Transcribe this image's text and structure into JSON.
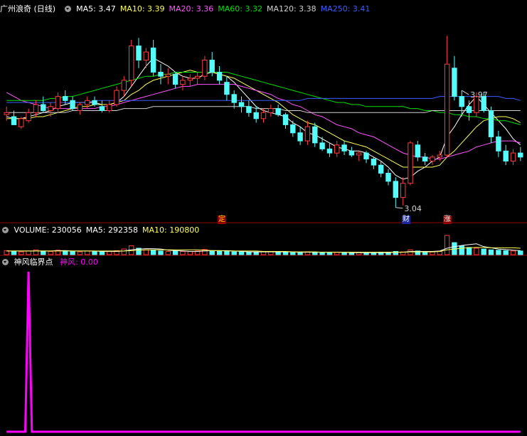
{
  "colors": {
    "up": "#ff3c3c",
    "down": "#54fcfc",
    "ma5": "#ffffff",
    "ma10": "#ffff54",
    "ma20": "#ff54ff",
    "ma60": "#00e000",
    "ma120": "#d0d0d0",
    "ma250": "#3c5cff",
    "grid": "#8b0000",
    "vol_ma5": "#ffffff",
    "vol_ma10": "#ffff54",
    "indicator": "#ff00ff"
  },
  "main_panel": {
    "title": "广州浪奇 (日线)",
    "ma_labels": [
      {
        "text": "MA5: 3.47",
        "color": "#ffffff"
      },
      {
        "text": "MA10: 3.39",
        "color": "#ffff54"
      },
      {
        "text": "MA20: 3.36",
        "color": "#ff54ff"
      },
      {
        "text": "MA60: 3.32",
        "color": "#00e000"
      },
      {
        "text": "MA120: 3.38",
        "color": "#d0d0d0"
      },
      {
        "text": "MA250: 3.41",
        "color": "#3c5cff"
      }
    ],
    "high_label": "3.97",
    "low_label": "3.04",
    "tags": [
      "定",
      "财",
      "涨"
    ]
  },
  "volume_panel": {
    "labels": [
      {
        "text": "VOLUME: 230056",
        "color": "#ffffff"
      },
      {
        "text": "MA5: 292358",
        "color": "#ffffff"
      },
      {
        "text": "MA10: 190800",
        "color": "#ffff54"
      }
    ]
  },
  "indicator_panel": {
    "name": "神风临界点",
    "series_label": "神风: 0.00"
  },
  "chart_data": [
    {
      "type": "candlestick",
      "title": "广州浪奇 (日线)",
      "ylim": [
        3.0,
        4.0
      ],
      "ohlc": [
        [
          3.51,
          3.55,
          3.48,
          3.52
        ],
        [
          3.5,
          3.53,
          3.46,
          3.46
        ],
        [
          3.45,
          3.5,
          3.44,
          3.49
        ],
        [
          3.48,
          3.54,
          3.47,
          3.52
        ],
        [
          3.52,
          3.58,
          3.5,
          3.56
        ],
        [
          3.56,
          3.6,
          3.52,
          3.53
        ],
        [
          3.53,
          3.57,
          3.5,
          3.55
        ],
        [
          3.54,
          3.62,
          3.52,
          3.6
        ],
        [
          3.6,
          3.63,
          3.56,
          3.58
        ],
        [
          3.58,
          3.6,
          3.53,
          3.54
        ],
        [
          3.53,
          3.57,
          3.51,
          3.56
        ],
        [
          3.56,
          3.6,
          3.54,
          3.58
        ],
        [
          3.58,
          3.6,
          3.55,
          3.56
        ],
        [
          3.55,
          3.58,
          3.52,
          3.53
        ],
        [
          3.53,
          3.58,
          3.52,
          3.56
        ],
        [
          3.56,
          3.65,
          3.55,
          3.63
        ],
        [
          3.63,
          3.7,
          3.6,
          3.68
        ],
        [
          3.68,
          3.88,
          3.65,
          3.85
        ],
        [
          3.85,
          3.89,
          3.74,
          3.78
        ],
        [
          3.78,
          3.84,
          3.74,
          3.82
        ],
        [
          3.84,
          3.88,
          3.7,
          3.72
        ],
        [
          3.72,
          3.76,
          3.66,
          3.7
        ],
        [
          3.7,
          3.74,
          3.66,
          3.71
        ],
        [
          3.71,
          3.72,
          3.64,
          3.66
        ],
        [
          3.66,
          3.7,
          3.63,
          3.68
        ],
        [
          3.68,
          3.71,
          3.65,
          3.69
        ],
        [
          3.69,
          3.72,
          3.66,
          3.7
        ],
        [
          3.7,
          3.8,
          3.68,
          3.78
        ],
        [
          3.78,
          3.82,
          3.7,
          3.72
        ],
        [
          3.72,
          3.75,
          3.66,
          3.68
        ],
        [
          3.67,
          3.7,
          3.58,
          3.61
        ],
        [
          3.61,
          3.63,
          3.54,
          3.57
        ],
        [
          3.57,
          3.6,
          3.52,
          3.55
        ],
        [
          3.55,
          3.58,
          3.5,
          3.52
        ],
        [
          3.52,
          3.55,
          3.47,
          3.49
        ],
        [
          3.49,
          3.54,
          3.47,
          3.52
        ],
        [
          3.52,
          3.56,
          3.5,
          3.54
        ],
        [
          3.54,
          3.56,
          3.5,
          3.51
        ],
        [
          3.51,
          3.52,
          3.44,
          3.46
        ],
        [
          3.46,
          3.48,
          3.4,
          3.42
        ],
        [
          3.42,
          3.45,
          3.36,
          3.38
        ],
        [
          3.38,
          3.48,
          3.36,
          3.45
        ],
        [
          3.45,
          3.47,
          3.35,
          3.37
        ],
        [
          3.37,
          3.4,
          3.33,
          3.34
        ],
        [
          3.34,
          3.37,
          3.3,
          3.32
        ],
        [
          3.32,
          3.38,
          3.3,
          3.36
        ],
        [
          3.36,
          3.38,
          3.31,
          3.33
        ],
        [
          3.33,
          3.35,
          3.3,
          3.31
        ],
        [
          3.31,
          3.33,
          3.28,
          3.32
        ],
        [
          3.32,
          3.33,
          3.27,
          3.29
        ],
        [
          3.29,
          3.3,
          3.24,
          3.26
        ],
        [
          3.26,
          3.28,
          3.2,
          3.22
        ],
        [
          3.22,
          3.24,
          3.16,
          3.18
        ],
        [
          3.18,
          3.2,
          3.05,
          3.1
        ],
        [
          3.1,
          3.2,
          3.06,
          3.17
        ],
        [
          3.17,
          3.38,
          3.16,
          3.37
        ],
        [
          3.36,
          3.38,
          3.28,
          3.3
        ],
        [
          3.3,
          3.32,
          3.26,
          3.28
        ],
        [
          3.28,
          3.31,
          3.26,
          3.3
        ],
        [
          3.3,
          3.33,
          3.28,
          3.31
        ],
        [
          3.31,
          3.9,
          3.3,
          3.76
        ],
        [
          3.74,
          3.8,
          3.58,
          3.6
        ],
        [
          3.6,
          3.63,
          3.5,
          3.55
        ],
        [
          3.55,
          3.58,
          3.48,
          3.52
        ],
        [
          3.52,
          3.62,
          3.5,
          3.6
        ],
        [
          3.6,
          3.62,
          3.52,
          3.53
        ],
        [
          3.53,
          3.55,
          3.37,
          3.4
        ],
        [
          3.4,
          3.43,
          3.3,
          3.33
        ],
        [
          3.33,
          3.36,
          3.26,
          3.28
        ],
        [
          3.28,
          3.34,
          3.26,
          3.32
        ],
        [
          3.32,
          3.35,
          3.28,
          3.3
        ]
      ],
      "moving_averages": {
        "MA5": [
          3.5,
          3.49,
          3.49,
          3.5,
          3.51,
          3.52,
          3.53,
          3.55,
          3.56,
          3.57,
          3.57,
          3.57,
          3.57,
          3.56,
          3.56,
          3.57,
          3.6,
          3.65,
          3.7,
          3.75,
          3.79,
          3.77,
          3.75,
          3.72,
          3.7,
          3.69,
          3.69,
          3.71,
          3.72,
          3.71,
          3.7,
          3.67,
          3.63,
          3.59,
          3.55,
          3.53,
          3.52,
          3.51,
          3.5,
          3.47,
          3.45,
          3.42,
          3.41,
          3.39,
          3.37,
          3.35,
          3.34,
          3.33,
          3.33,
          3.32,
          3.3,
          3.28,
          3.25,
          3.21,
          3.19,
          3.2,
          3.23,
          3.25,
          3.28,
          3.3,
          3.4,
          3.45,
          3.51,
          3.56,
          3.6,
          3.56,
          3.52,
          3.48,
          3.44,
          3.39,
          3.36
        ],
        "MA10": [
          3.49,
          3.49,
          3.49,
          3.49,
          3.5,
          3.5,
          3.51,
          3.52,
          3.53,
          3.54,
          3.55,
          3.55,
          3.56,
          3.56,
          3.56,
          3.57,
          3.58,
          3.61,
          3.63,
          3.66,
          3.68,
          3.69,
          3.7,
          3.71,
          3.72,
          3.73,
          3.72,
          3.72,
          3.72,
          3.71,
          3.7,
          3.69,
          3.67,
          3.65,
          3.63,
          3.61,
          3.59,
          3.57,
          3.54,
          3.51,
          3.49,
          3.47,
          3.46,
          3.44,
          3.42,
          3.4,
          3.38,
          3.37,
          3.36,
          3.35,
          3.33,
          3.31,
          3.29,
          3.27,
          3.25,
          3.25,
          3.25,
          3.25,
          3.25,
          3.26,
          3.3,
          3.33,
          3.37,
          3.41,
          3.45,
          3.48,
          3.49,
          3.5,
          3.5,
          3.49,
          3.47
        ],
        "MA20": [
          3.62,
          3.6,
          3.58,
          3.57,
          3.56,
          3.55,
          3.54,
          3.54,
          3.54,
          3.54,
          3.54,
          3.54,
          3.54,
          3.55,
          3.55,
          3.56,
          3.57,
          3.58,
          3.59,
          3.6,
          3.61,
          3.62,
          3.63,
          3.64,
          3.65,
          3.65,
          3.66,
          3.66,
          3.66,
          3.66,
          3.66,
          3.66,
          3.65,
          3.64,
          3.63,
          3.62,
          3.61,
          3.59,
          3.58,
          3.56,
          3.55,
          3.53,
          3.51,
          3.5,
          3.48,
          3.46,
          3.45,
          3.44,
          3.42,
          3.41,
          3.4,
          3.38,
          3.36,
          3.34,
          3.32,
          3.31,
          3.3,
          3.3,
          3.29,
          3.29,
          3.3,
          3.31,
          3.32,
          3.33,
          3.35,
          3.36,
          3.37,
          3.38,
          3.38,
          3.38,
          3.37
        ],
        "MA60": [
          3.58,
          3.58,
          3.58,
          3.58,
          3.58,
          3.58,
          3.59,
          3.59,
          3.6,
          3.6,
          3.61,
          3.62,
          3.63,
          3.64,
          3.65,
          3.66,
          3.67,
          3.68,
          3.69,
          3.7,
          3.7,
          3.71,
          3.71,
          3.72,
          3.72,
          3.72,
          3.72,
          3.72,
          3.72,
          3.72,
          3.72,
          3.71,
          3.7,
          3.69,
          3.68,
          3.67,
          3.66,
          3.65,
          3.64,
          3.63,
          3.62,
          3.61,
          3.6,
          3.59,
          3.58,
          3.57,
          3.57,
          3.56,
          3.56,
          3.55,
          3.55,
          3.55,
          3.55,
          3.55,
          3.55,
          3.54,
          3.54,
          3.53,
          3.53,
          3.52,
          3.52,
          3.51,
          3.51,
          3.5,
          3.5,
          3.49,
          3.49,
          3.48,
          3.48,
          3.47,
          3.46
        ],
        "MA120": [
          3.52,
          3.52,
          3.52,
          3.52,
          3.52,
          3.52,
          3.52,
          3.52,
          3.52,
          3.53,
          3.53,
          3.53,
          3.53,
          3.53,
          3.53,
          3.53,
          3.54,
          3.54,
          3.54,
          3.54,
          3.55,
          3.55,
          3.55,
          3.55,
          3.55,
          3.55,
          3.55,
          3.55,
          3.55,
          3.55,
          3.55,
          3.55,
          3.55,
          3.55,
          3.54,
          3.54,
          3.54,
          3.54,
          3.53,
          3.53,
          3.53,
          3.52,
          3.52,
          3.52,
          3.52,
          3.52,
          3.52,
          3.52,
          3.52,
          3.52,
          3.52,
          3.52,
          3.52,
          3.52,
          3.52,
          3.52,
          3.52,
          3.52,
          3.53,
          3.53,
          3.53,
          3.53,
          3.53,
          3.53,
          3.53,
          3.53,
          3.53,
          3.53,
          3.53,
          3.53,
          3.53
        ],
        "MA250": [
          3.57,
          3.57,
          3.57,
          3.57,
          3.57,
          3.57,
          3.57,
          3.57,
          3.57,
          3.57,
          3.57,
          3.57,
          3.58,
          3.58,
          3.58,
          3.58,
          3.58,
          3.58,
          3.58,
          3.58,
          3.58,
          3.58,
          3.58,
          3.58,
          3.58,
          3.58,
          3.58,
          3.58,
          3.58,
          3.58,
          3.58,
          3.58,
          3.58,
          3.58,
          3.58,
          3.58,
          3.58,
          3.58,
          3.58,
          3.58,
          3.58,
          3.59,
          3.59,
          3.59,
          3.59,
          3.59,
          3.59,
          3.59,
          3.59,
          3.59,
          3.59,
          3.59,
          3.59,
          3.59,
          3.59,
          3.59,
          3.59,
          3.59,
          3.59,
          3.6,
          3.6,
          3.6,
          3.6,
          3.6,
          3.6,
          3.6,
          3.6,
          3.6,
          3.59,
          3.59,
          3.58
        ]
      },
      "annotations": [
        {
          "text": "3.97",
          "bar": 62
        },
        {
          "text": "3.04",
          "bar": 53
        }
      ],
      "events": [
        {
          "text": "定",
          "bar": 30
        },
        {
          "text": "财",
          "bar": 55
        },
        {
          "text": "涨",
          "bar": 61
        }
      ]
    },
    {
      "type": "bar",
      "title": "VOLUME",
      "values": [
        10,
        8,
        7,
        9,
        12,
        9,
        8,
        11,
        10,
        8,
        7,
        9,
        8,
        7,
        8,
        10,
        14,
        22,
        16,
        12,
        11,
        9,
        8,
        9,
        8,
        8,
        9,
        13,
        10,
        9,
        8,
        7,
        7,
        6,
        6,
        7,
        8,
        7,
        6,
        6,
        6,
        7,
        6,
        5,
        5,
        6,
        5,
        5,
        5,
        5,
        5,
        6,
        6,
        8,
        7,
        12,
        9,
        7,
        7,
        8,
        48,
        30,
        22,
        18,
        16,
        14,
        12,
        11,
        10,
        9,
        9
      ],
      "ma5": [
        9,
        9,
        9,
        9,
        9,
        9,
        9,
        10,
        10,
        9,
        9,
        9,
        9,
        8,
        8,
        8,
        9,
        12,
        14,
        15,
        15,
        14,
        11,
        10,
        9,
        8,
        8,
        9,
        10,
        10,
        10,
        9,
        8,
        7,
        7,
        7,
        7,
        7,
        7,
        7,
        6,
        6,
        6,
        6,
        6,
        6,
        6,
        5,
        5,
        5,
        5,
        5,
        5,
        6,
        6,
        8,
        8,
        8,
        8,
        9,
        16,
        20,
        23,
        25,
        27,
        20,
        17,
        14,
        13,
        11,
        10
      ],
      "ma10": [
        9,
        9,
        9,
        9,
        9,
        9,
        9,
        9,
        9,
        9,
        9,
        9,
        9,
        9,
        9,
        9,
        9,
        10,
        11,
        12,
        12,
        12,
        12,
        12,
        12,
        12,
        12,
        11,
        10,
        10,
        9,
        9,
        9,
        9,
        9,
        8,
        8,
        8,
        8,
        7,
        7,
        7,
        7,
        6,
        6,
        6,
        6,
        6,
        6,
        6,
        6,
        6,
        6,
        6,
        6,
        7,
        7,
        7,
        7,
        8,
        12,
        14,
        16,
        17,
        18,
        18,
        17,
        17,
        17,
        17,
        16
      ]
    },
    {
      "type": "line",
      "title": "神风临界点",
      "series": [
        {
          "name": "神风",
          "values": [
            0,
            0,
            0,
            0,
            0,
            0,
            0,
            0,
            0,
            0,
            0,
            0,
            0,
            0,
            0,
            0,
            0,
            0,
            0,
            0,
            0,
            0,
            0,
            0,
            0,
            0,
            0,
            0,
            0,
            0,
            0,
            0,
            0,
            0,
            0,
            0,
            0,
            0,
            0,
            0,
            0,
            0,
            0,
            0,
            0,
            0,
            0,
            0,
            0,
            0,
            0,
            0,
            0,
            0,
            0,
            0,
            0,
            0,
            0,
            0,
            0,
            0,
            0,
            0,
            0,
            0,
            0,
            0,
            0,
            0,
            0
          ]
        }
      ],
      "spike": {
        "value": 1,
        "index": 3
      },
      "ylim": [
        0,
        1
      ]
    }
  ]
}
